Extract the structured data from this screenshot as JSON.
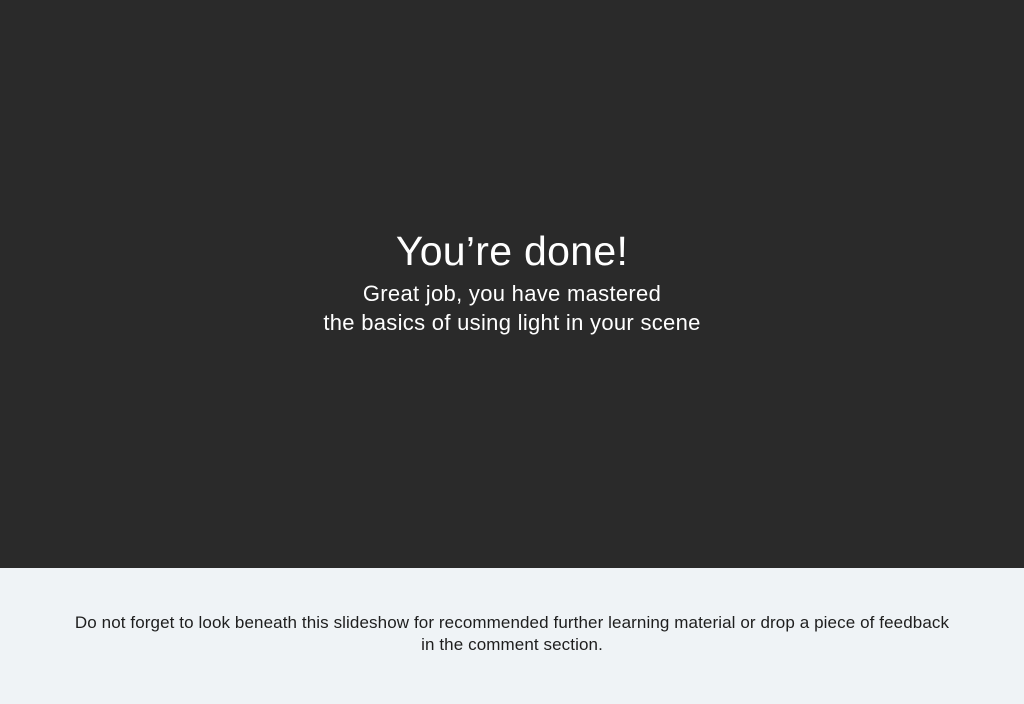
{
  "slide": {
    "background_color": "#2a2a2a",
    "title": "You’re done!",
    "subtitle_line1": "Great job, you have mastered",
    "subtitle_line2": "the basics of using light in your scene"
  },
  "footer": {
    "background_color": "#eff3f6",
    "note_line1": "Do not forget to look beneath this slideshow for recommended further learning material or drop a piece of feedback",
    "note_line2": "in the comment section."
  }
}
